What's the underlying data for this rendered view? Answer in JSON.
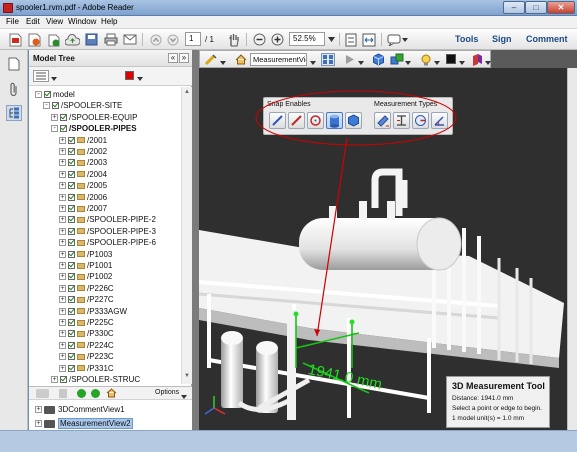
{
  "window": {
    "title": "spooler1.rvm.pdf - Adobe Reader",
    "minimize_glyph": "–",
    "maximize_glyph": "□",
    "close_glyph": "✕"
  },
  "menu": [
    "File",
    "Edit",
    "View",
    "Window",
    "Help"
  ],
  "toolbar": {
    "page_current": "1",
    "page_total": "/ 1",
    "zoom": "52.5%",
    "tools_label": "Tools",
    "sign_label": "Sign",
    "comment_label": "Comment"
  },
  "model_tree": {
    "title": "Model Tree",
    "collapse_glyph": "«",
    "options_glyph": "»",
    "color_swatch": "#e00000",
    "nodes": [
      {
        "label": "model",
        "level": 0,
        "expander": "-",
        "folder": false
      },
      {
        "label": "/SPOOLER-SITE",
        "level": 1,
        "expander": "-",
        "folder": false
      },
      {
        "label": "/SPOOLER-EQUIP",
        "level": 2,
        "expander": "+",
        "folder": false
      },
      {
        "label": "/SPOOLER-PIPES",
        "level": 2,
        "expander": "-",
        "folder": false,
        "bold": true
      },
      {
        "label": "/2001",
        "level": 3,
        "expander": "+",
        "folder": true
      },
      {
        "label": "/2002",
        "level": 3,
        "expander": "+",
        "folder": true
      },
      {
        "label": "/2003",
        "level": 3,
        "expander": "+",
        "folder": true
      },
      {
        "label": "/2004",
        "level": 3,
        "expander": "+",
        "folder": true
      },
      {
        "label": "/2005",
        "level": 3,
        "expander": "+",
        "folder": true
      },
      {
        "label": "/2006",
        "level": 3,
        "expander": "+",
        "folder": true
      },
      {
        "label": "/2007",
        "level": 3,
        "expander": "+",
        "folder": true
      },
      {
        "label": "/SPOOLER-PIPE-2",
        "level": 3,
        "expander": "+",
        "folder": true
      },
      {
        "label": "/SPOOLER-PIPE-3",
        "level": 3,
        "expander": "+",
        "folder": true
      },
      {
        "label": "/SPOOLER-PIPE-6",
        "level": 3,
        "expander": "+",
        "folder": true
      },
      {
        "label": "/P1003",
        "level": 3,
        "expander": "+",
        "folder": true
      },
      {
        "label": "/P1001",
        "level": 3,
        "expander": "+",
        "folder": true
      },
      {
        "label": "/P1002",
        "level": 3,
        "expander": "+",
        "folder": true
      },
      {
        "label": "/P226C",
        "level": 3,
        "expander": "+",
        "folder": true
      },
      {
        "label": "/P227C",
        "level": 3,
        "expander": "+",
        "folder": true
      },
      {
        "label": "/P333AGW",
        "level": 3,
        "expander": "+",
        "folder": true
      },
      {
        "label": "/P225C",
        "level": 3,
        "expander": "+",
        "folder": true
      },
      {
        "label": "/P330C",
        "level": 3,
        "expander": "+",
        "folder": true
      },
      {
        "label": "/P224C",
        "level": 3,
        "expander": "+",
        "folder": true
      },
      {
        "label": "/P223C",
        "level": 3,
        "expander": "+",
        "folder": true
      },
      {
        "label": "/P331C",
        "level": 3,
        "expander": "+",
        "folder": true
      },
      {
        "label": "/SPOOLER-STRUC",
        "level": 2,
        "expander": "+",
        "folder": false
      }
    ]
  },
  "views": {
    "options_label": "Options",
    "items": [
      "3DCommentView1",
      "MeasurementView2"
    ],
    "selected_index": 1
  },
  "view_toolbar": {
    "view_select": "MeasurementVie"
  },
  "snap_panel": {
    "snap_label": "Snap Enables",
    "measure_label": "Measurement Types"
  },
  "measurement": {
    "value": "1941.0 mm"
  },
  "info_box": {
    "title": "3D Measurement Tool",
    "distance": "Distance: 1941.0 mm",
    "instruction": "Select a point or edge to begin.",
    "unit": "1 model unit(s) = 1.0 mm"
  },
  "colors": {
    "highlight_ellipse": "#d00000",
    "measure_green": "#00c000",
    "link_blue": "#1c4a83"
  }
}
